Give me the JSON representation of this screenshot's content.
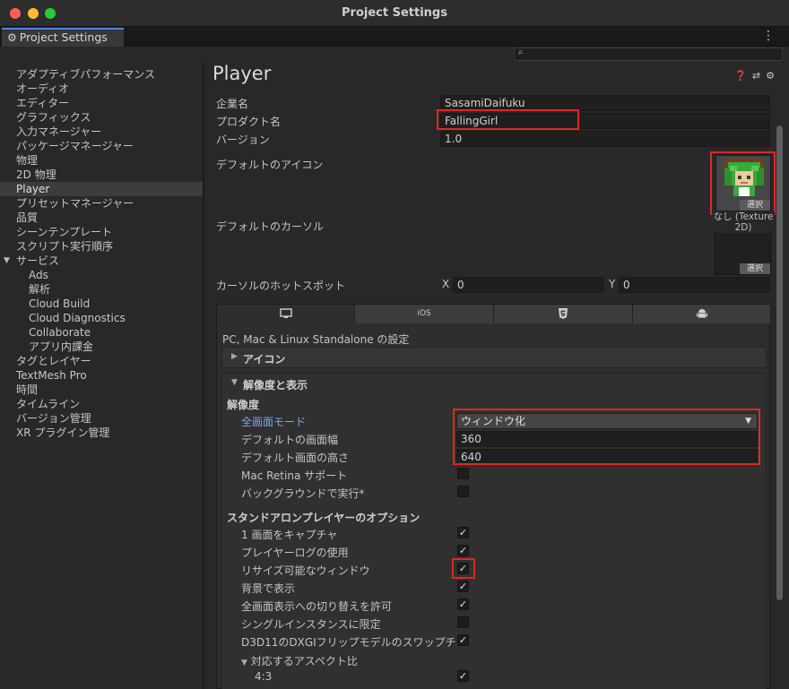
{
  "window": {
    "title": "Project Settings"
  },
  "tab": {
    "label": "Project Settings"
  },
  "search": {
    "placeholder": ""
  },
  "sidebar": {
    "items": [
      {
        "label": "アダプティブパフォーマンス"
      },
      {
        "label": "オーディオ"
      },
      {
        "label": "エディター"
      },
      {
        "label": "グラフィックス"
      },
      {
        "label": "入力マネージャー"
      },
      {
        "label": "パッケージマネージャー"
      },
      {
        "label": "物理"
      },
      {
        "label": "2D 物理"
      },
      {
        "label": "Player"
      },
      {
        "label": "プリセットマネージャー"
      },
      {
        "label": "品質"
      },
      {
        "label": "シーンテンプレート"
      },
      {
        "label": "スクリプト実行順序"
      },
      {
        "label": "サービス"
      },
      {
        "label": "Ads"
      },
      {
        "label": "解析"
      },
      {
        "label": "Cloud Build"
      },
      {
        "label": "Cloud Diagnostics"
      },
      {
        "label": "Collaborate"
      },
      {
        "label": "アプリ内課金"
      },
      {
        "label": "タグとレイヤー"
      },
      {
        "label": "TextMesh Pro"
      },
      {
        "label": "時間"
      },
      {
        "label": "タイムライン"
      },
      {
        "label": "バージョン管理"
      },
      {
        "label": "XR プラグイン管理"
      }
    ],
    "selected": "Player",
    "expanded_group": "サービス"
  },
  "player": {
    "title": "Player",
    "header_icons": [
      "help-icon",
      "preset-icon",
      "settings-icon"
    ],
    "company_label": "企業名",
    "company_value": "SasamiDaifuku",
    "product_label": "プロダクト名",
    "product_value": "FallingGirl",
    "version_label": "バージョン",
    "version_value": "1.0",
    "icon_label": "デフォルトのアイコン",
    "select_label": "選択",
    "cursor_label": "デフォルトのカーソル",
    "cursor_none_line1": "なし (Texture",
    "cursor_none_line2": "2D)",
    "hotspot_label": "カーソルのホットスポット",
    "hotspot_x_label": "X",
    "hotspot_x": "0",
    "hotspot_y_label": "Y",
    "hotspot_y": "0"
  },
  "platform": {
    "tabs": [
      {
        "name": "standalone",
        "icon": "monitor-icon",
        "label": ""
      },
      {
        "name": "ios",
        "icon": "",
        "label": "iOS"
      },
      {
        "name": "webgl",
        "icon": "html5-icon",
        "label": ""
      },
      {
        "name": "android",
        "icon": "android-icon",
        "label": ""
      }
    ],
    "settings_title": "PC, Mac & Linux Standalone の設定",
    "icon_section": "アイコン",
    "resolution_section": "解像度と表示",
    "resolution_head": "解像度",
    "fullscreen_label": "全画面モード",
    "fullscreen_value": "ウィンドウ化",
    "default_width_label": "デフォルトの画面幅",
    "default_width": "360",
    "default_height_label": "デフォルト画面の高さ",
    "default_height": "640",
    "mac_retina_label": "Mac Retina サポート",
    "mac_retina": false,
    "run_bg_label": "バックグラウンドで実行*",
    "run_bg": false,
    "standalone_head": "スタンドアロンプレイヤーのオプション",
    "options": [
      {
        "label": "1 画面をキャプチャ",
        "checked": true
      },
      {
        "label": "プレイヤーログの使用",
        "checked": true
      },
      {
        "label": "リサイズ可能なウィンドウ",
        "checked": true
      },
      {
        "label": "背景で表示",
        "checked": true
      },
      {
        "label": "全画面表示への切り替えを許可",
        "checked": true
      },
      {
        "label": "シングルインスタンスに限定",
        "checked": false
      },
      {
        "label": "D3D11のDXGIフリップモデルのスワップチ",
        "checked": true
      }
    ],
    "aspect_head": "対応するアスペクト比",
    "aspect_43_label": "4:3",
    "aspect_43": true
  },
  "colors": {
    "highlight_box": "#e0281f",
    "selection": "#3c3c3c",
    "accent_blue": "#7fa6e4"
  }
}
